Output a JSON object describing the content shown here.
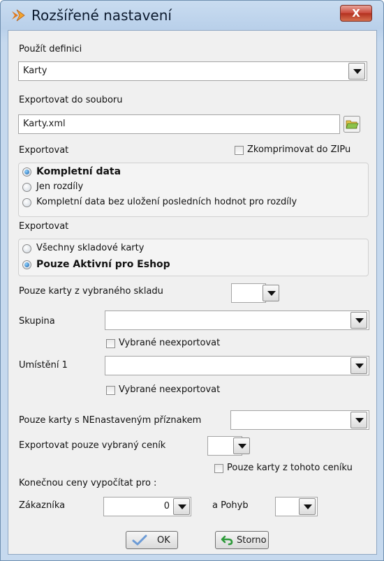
{
  "window": {
    "title": "Rozšířené nastavení",
    "close_label": "X"
  },
  "definition": {
    "label": "Použít definici",
    "value": "Karty"
  },
  "export_file": {
    "label": "Exportovat do souboru",
    "value": "Karty.xml"
  },
  "export1": {
    "label": "Exportovat",
    "zip_label": "Zkomprimovat do ZIPu",
    "options": [
      {
        "label": "Kompletní data",
        "selected": true
      },
      {
        "label": "Jen rozdíly",
        "selected": false
      },
      {
        "label": "Kompletní data bez uložení posledních hodnot pro rozdíly",
        "selected": false
      }
    ]
  },
  "export2": {
    "label": "Exportovat",
    "options": [
      {
        "label": "Všechny skladové karty",
        "selected": false
      },
      {
        "label": "Pouze Aktivní pro Eshop",
        "selected": true
      }
    ]
  },
  "warehouse": {
    "label": "Pouze karty z vybraného skladu",
    "value": ""
  },
  "group": {
    "label": "Skupina",
    "value": "",
    "exclude_label": "Vybrané neexportovat"
  },
  "location": {
    "label": "Umístění 1",
    "value": "",
    "exclude_label": "Vybrané neexportovat"
  },
  "flag": {
    "label": "Pouze karty s NEnastaveným příznakem",
    "value": ""
  },
  "pricelist": {
    "label": "Exportovat pouze vybraný ceník",
    "value": "",
    "only_label": "Pouze karty z tohoto ceníku"
  },
  "price_calc": {
    "label": "Konečnou ceny vypočítat pro :",
    "customer_label": "Zákazníka",
    "customer_value": "0",
    "movement_label": "a Pohyb",
    "movement_value": ""
  },
  "buttons": {
    "ok": "OK",
    "cancel": "Storno"
  }
}
